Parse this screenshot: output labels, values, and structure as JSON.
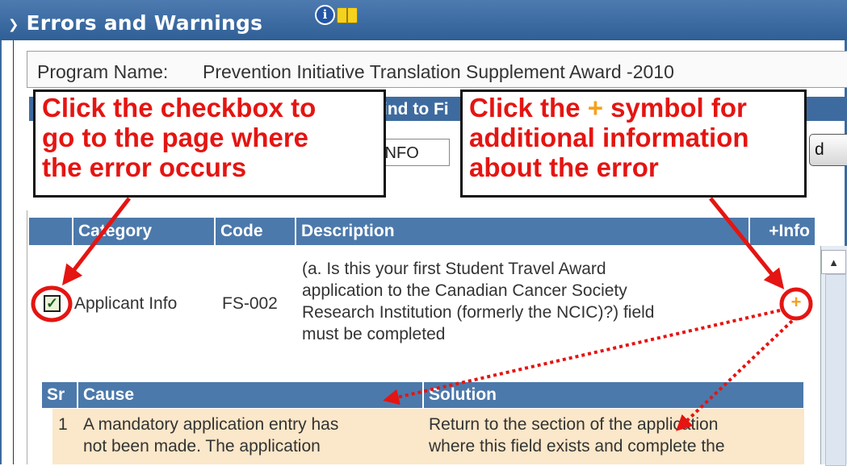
{
  "window": {
    "title": "Errors and Warnings",
    "icons": [
      "info-icon",
      "book-icon"
    ]
  },
  "program": {
    "label": "Program Name:",
    "value": "Prevention Initiative Translation Supplement Award -2010"
  },
  "background_controls": {
    "find_label": "ind to Fi",
    "field_value": "INFO",
    "button_partial": "d"
  },
  "callouts": {
    "left": [
      "Click the checkbox to",
      "go to the page where",
      "the error occurs"
    ],
    "right_line1_prefix": "Click the ",
    "right_line1_plus": "+",
    "right_line1_suffix": " symbol for",
    "right_line2": "additional information",
    "right_line3": "about the error"
  },
  "errors_table": {
    "columns": [
      "",
      "Category",
      "Code",
      "Description",
      "+Info"
    ],
    "rows": [
      {
        "checked": true,
        "category": "Applicant Info",
        "code": "FS-002",
        "description_lines": [
          "(a. Is this your first Student Travel Award",
          "application to the Canadian Cancer Society",
          "Research Institution (formerly the NCIC)?) field",
          "must be completed"
        ],
        "info": "+"
      }
    ]
  },
  "detail_table": {
    "columns": [
      "Sr",
      "Cause",
      "Solution"
    ],
    "rows": [
      {
        "sr": "1",
        "cause_lines": [
          "A mandatory application entry has",
          "not been made. The application"
        ],
        "solution_lines": [
          "Return to the section of the application",
          "where this field exists and complete the"
        ]
      }
    ]
  },
  "colors": {
    "title_bar": "#3b6a9f",
    "header_blue": "#4c79ab",
    "callout_text": "#e41512",
    "plus_orange": "#f5a11d",
    "detail_row": "#fbe7c9"
  }
}
